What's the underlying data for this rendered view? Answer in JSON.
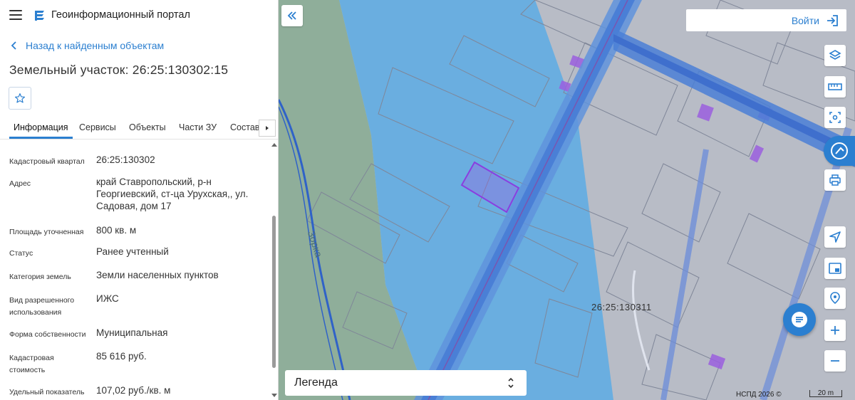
{
  "app": {
    "title": "Геоинформационный портал"
  },
  "nav": {
    "back_label": "Назад к найденным объектам"
  },
  "object": {
    "title": "Земельный участок: 26:25:130302:15"
  },
  "tabs": [
    {
      "label": "Информация",
      "active": true
    },
    {
      "label": "Сервисы"
    },
    {
      "label": "Объекты"
    },
    {
      "label": "Части ЗУ"
    },
    {
      "label": "Состав"
    }
  ],
  "info_rows": [
    {
      "label": "Кадастровый квартал",
      "value": "26:25:130302"
    },
    {
      "label": "Адрес",
      "value": "край Ставропольский, р-н Георгиевский, ст-ца Урухская,, ул. Садовая, дом 17"
    },
    {
      "label": "Площадь уточненная",
      "value": "800 кв. м"
    },
    {
      "label": "Статус",
      "value": "Ранее учтенный"
    },
    {
      "label": "Категория земель",
      "value": "Земли населенных пунктов"
    },
    {
      "label": "Вид разрешенного использования",
      "value": "ИЖС"
    },
    {
      "label": "Форма собственности",
      "value": "Муниципальная"
    },
    {
      "label": "Кадастровая стоимость",
      "value": "85 616 руб."
    },
    {
      "label": "Удельный показатель",
      "value": "107,02 руб./кв. м"
    }
  ],
  "map": {
    "login_label": "Войти",
    "legend_label": "Легенда",
    "attribution": "НСПД 2026 ©",
    "scale_label": "20 m",
    "quarter_label": "26:25:130311",
    "street_label": "Зорка"
  },
  "colors": {
    "accent": "#2b7fd0",
    "water_zone": "#6aaee0",
    "parcel_highlight": "#9b5fe0"
  }
}
